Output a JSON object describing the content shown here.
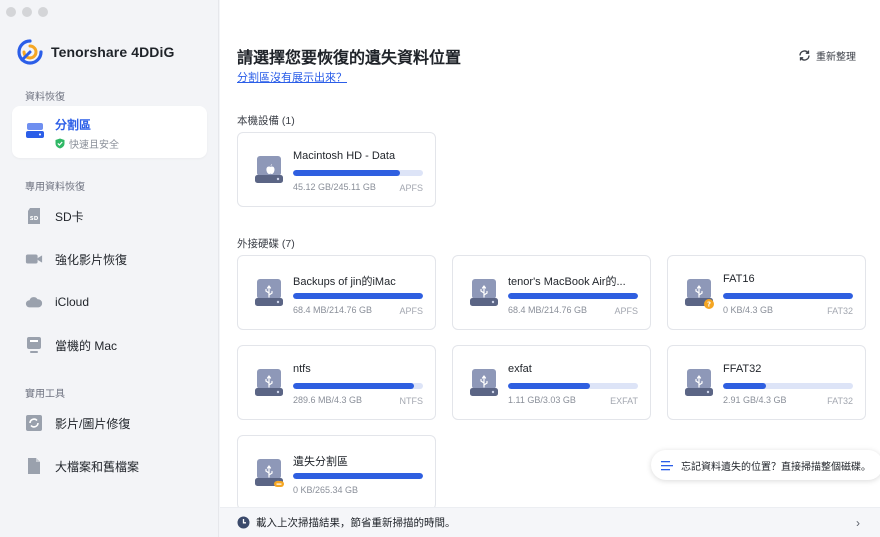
{
  "app": {
    "name": "Tenorshare 4DDiG"
  },
  "sidebar": {
    "sections": [
      {
        "title": "資料恢復"
      },
      {
        "title": "專用資料恢復"
      },
      {
        "title": "實用工具"
      }
    ],
    "active_item": {
      "label": "分割區",
      "sub": "快速且安全"
    },
    "items": [
      {
        "label": "SD卡"
      },
      {
        "label": "強化影片恢復"
      },
      {
        "label": "iCloud"
      },
      {
        "label": "當機的 Mac"
      },
      {
        "label": "影片/圖片修復"
      },
      {
        "label": "大檔案和舊檔案"
      }
    ]
  },
  "main": {
    "title": "請選擇您要恢復的遺失資料位置",
    "help_link": "分割區沒有展示出來？",
    "refresh_label": "重新整理",
    "local_group": "本機設備 (1)",
    "external_group": "外接硬碟 (7)",
    "local_drives": [
      {
        "name": "Macintosh HD - Data",
        "size": "45.12 GB/245.11 GB",
        "fs": "APFS",
        "usage": 0.82
      }
    ],
    "external_drives": [
      {
        "name": "Backups of jin的iMac",
        "size": "68.4 MB/214.76 GB",
        "fs": "APFS",
        "usage": 1.0
      },
      {
        "name": "tenor's MacBook Air的...",
        "size": "68.4 MB/214.76 GB",
        "fs": "APFS",
        "usage": 1.0
      },
      {
        "name": "FAT16",
        "size": "0 KB/4.3 GB",
        "fs": "FAT32",
        "usage": 1.0
      },
      {
        "name": "ntfs",
        "size": "289.6 MB/4.3 GB",
        "fs": "NTFS",
        "usage": 0.93
      },
      {
        "name": "exfat",
        "size": "1.11 GB/3.03 GB",
        "fs": "EXFAT",
        "usage": 0.63
      },
      {
        "name": "FFAT32",
        "size": "2.91 GB/4.3 GB",
        "fs": "FAT32",
        "usage": 0.33
      },
      {
        "name": "遺失分割區",
        "size": "0 KB/265.34 GB",
        "fs": "",
        "usage": 1.0
      }
    ],
    "tip": "忘記資料遺失的位置？直接掃描整個磁碟。",
    "bottom_bar": "載入上次掃描結果，節省重新掃描的時間。"
  },
  "colors": {
    "accent": "#2b5ee8",
    "bar_fill": "#2f5fe0",
    "bar_track": "#dde4f7",
    "warning_badge": "#f5a623"
  }
}
